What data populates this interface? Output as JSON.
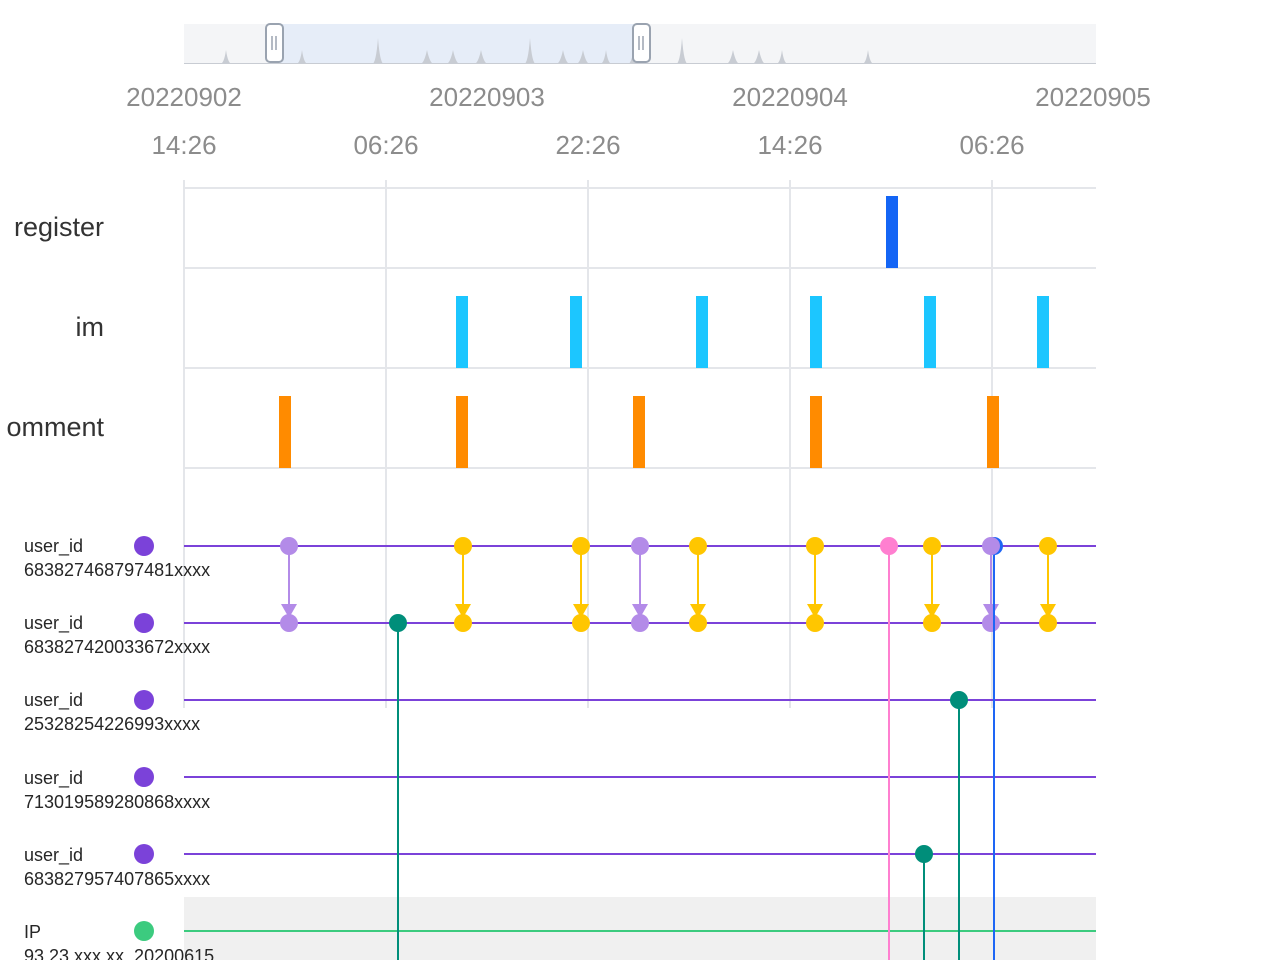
{
  "timeline": {
    "date_labels": [
      "20220902",
      "20220903",
      "20220904",
      "20220905"
    ],
    "time_labels": [
      "14:26",
      "06:26",
      "22:26",
      "14:26",
      "06:26"
    ]
  },
  "tracks": [
    {
      "label": "register",
      "color": "#1465f5"
    },
    {
      "label": "im",
      "color": "#1cc6ff"
    },
    {
      "label": "omment",
      "color": "#ff8b00"
    }
  ],
  "entities": [
    {
      "type": "user_id",
      "value": "683827468797481xxxx",
      "color": "#7b42d9"
    },
    {
      "type": "user_id",
      "value": "683827420033672xxxx",
      "color": "#7b42d9"
    },
    {
      "type": "user_id",
      "value": "25328254226993xxxx",
      "color": "#7b42d9"
    },
    {
      "type": "user_id",
      "value": "713019589280868xxxx",
      "color": "#7b42d9"
    },
    {
      "type": "user_id",
      "value": "683827957407865xxxx",
      "color": "#7b42d9"
    },
    {
      "type": "IP",
      "value": "93.23.xxx.xx_20200615",
      "color": "#3ccb7f"
    }
  ],
  "colors": {
    "link_purple": "#b38be8",
    "link_yellow": "#ffc600",
    "link_pink": "#ff7fd0",
    "link_teal": "#008e7a",
    "link_blue": "#1e66f5",
    "grid": "#e4e6ea",
    "brush_fill": "#e6edf8",
    "axis_text": "#8c8c8c"
  }
}
